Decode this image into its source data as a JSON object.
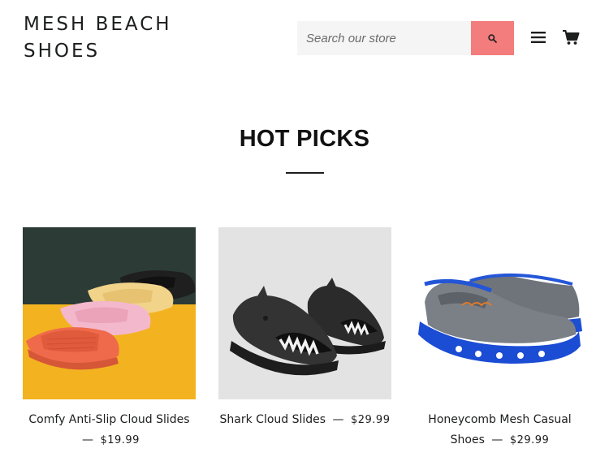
{
  "header": {
    "logo_line1": "MESH BEACH",
    "logo_line2": "SHOES",
    "search_placeholder": "Search our store",
    "search_button_icon": "search-icon",
    "menu_icon": "hamburger-menu-icon",
    "cart_icon": "cart-icon"
  },
  "section": {
    "title": "HOT PICKS"
  },
  "products": [
    {
      "name": "Comfy Anti-Slip Cloud Slides",
      "dash": "—",
      "price": "$19.99"
    },
    {
      "name": "Shark Cloud Slides",
      "dash": "—",
      "price": "$29.99"
    },
    {
      "name_line1": "Honeycomb Mesh Casual",
      "name_line2": "Shoes",
      "dash": "—",
      "price": "$29.99"
    }
  ],
  "colors": {
    "accent": "#f37c7c",
    "text": "#1c1d1d",
    "search_bg": "#f5f5f5"
  }
}
